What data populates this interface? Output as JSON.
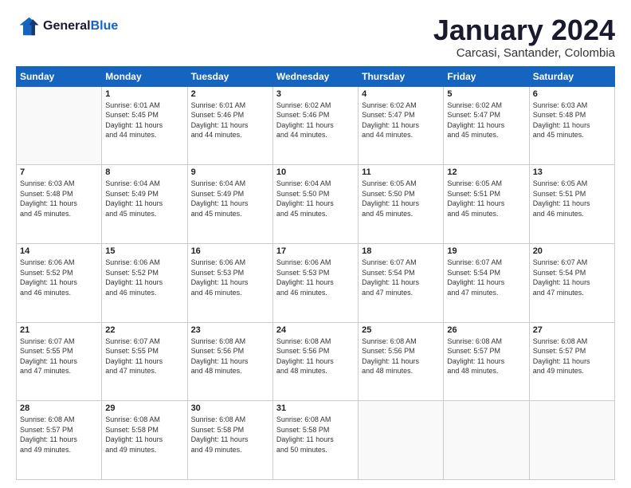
{
  "header": {
    "logo_general": "General",
    "logo_blue": "Blue",
    "month_title": "January 2024",
    "subtitle": "Carcasi, Santander, Colombia"
  },
  "days_of_week": [
    "Sunday",
    "Monday",
    "Tuesday",
    "Wednesday",
    "Thursday",
    "Friday",
    "Saturday"
  ],
  "weeks": [
    [
      {
        "day": "",
        "info": ""
      },
      {
        "day": "1",
        "info": "Sunrise: 6:01 AM\nSunset: 5:45 PM\nDaylight: 11 hours\nand 44 minutes."
      },
      {
        "day": "2",
        "info": "Sunrise: 6:01 AM\nSunset: 5:46 PM\nDaylight: 11 hours\nand 44 minutes."
      },
      {
        "day": "3",
        "info": "Sunrise: 6:02 AM\nSunset: 5:46 PM\nDaylight: 11 hours\nand 44 minutes."
      },
      {
        "day": "4",
        "info": "Sunrise: 6:02 AM\nSunset: 5:47 PM\nDaylight: 11 hours\nand 44 minutes."
      },
      {
        "day": "5",
        "info": "Sunrise: 6:02 AM\nSunset: 5:47 PM\nDaylight: 11 hours\nand 45 minutes."
      },
      {
        "day": "6",
        "info": "Sunrise: 6:03 AM\nSunset: 5:48 PM\nDaylight: 11 hours\nand 45 minutes."
      }
    ],
    [
      {
        "day": "7",
        "info": "Sunrise: 6:03 AM\nSunset: 5:48 PM\nDaylight: 11 hours\nand 45 minutes."
      },
      {
        "day": "8",
        "info": "Sunrise: 6:04 AM\nSunset: 5:49 PM\nDaylight: 11 hours\nand 45 minutes."
      },
      {
        "day": "9",
        "info": "Sunrise: 6:04 AM\nSunset: 5:49 PM\nDaylight: 11 hours\nand 45 minutes."
      },
      {
        "day": "10",
        "info": "Sunrise: 6:04 AM\nSunset: 5:50 PM\nDaylight: 11 hours\nand 45 minutes."
      },
      {
        "day": "11",
        "info": "Sunrise: 6:05 AM\nSunset: 5:50 PM\nDaylight: 11 hours\nand 45 minutes."
      },
      {
        "day": "12",
        "info": "Sunrise: 6:05 AM\nSunset: 5:51 PM\nDaylight: 11 hours\nand 45 minutes."
      },
      {
        "day": "13",
        "info": "Sunrise: 6:05 AM\nSunset: 5:51 PM\nDaylight: 11 hours\nand 46 minutes."
      }
    ],
    [
      {
        "day": "14",
        "info": "Sunrise: 6:06 AM\nSunset: 5:52 PM\nDaylight: 11 hours\nand 46 minutes."
      },
      {
        "day": "15",
        "info": "Sunrise: 6:06 AM\nSunset: 5:52 PM\nDaylight: 11 hours\nand 46 minutes."
      },
      {
        "day": "16",
        "info": "Sunrise: 6:06 AM\nSunset: 5:53 PM\nDaylight: 11 hours\nand 46 minutes."
      },
      {
        "day": "17",
        "info": "Sunrise: 6:06 AM\nSunset: 5:53 PM\nDaylight: 11 hours\nand 46 minutes."
      },
      {
        "day": "18",
        "info": "Sunrise: 6:07 AM\nSunset: 5:54 PM\nDaylight: 11 hours\nand 47 minutes."
      },
      {
        "day": "19",
        "info": "Sunrise: 6:07 AM\nSunset: 5:54 PM\nDaylight: 11 hours\nand 47 minutes."
      },
      {
        "day": "20",
        "info": "Sunrise: 6:07 AM\nSunset: 5:54 PM\nDaylight: 11 hours\nand 47 minutes."
      }
    ],
    [
      {
        "day": "21",
        "info": "Sunrise: 6:07 AM\nSunset: 5:55 PM\nDaylight: 11 hours\nand 47 minutes."
      },
      {
        "day": "22",
        "info": "Sunrise: 6:07 AM\nSunset: 5:55 PM\nDaylight: 11 hours\nand 47 minutes."
      },
      {
        "day": "23",
        "info": "Sunrise: 6:08 AM\nSunset: 5:56 PM\nDaylight: 11 hours\nand 48 minutes."
      },
      {
        "day": "24",
        "info": "Sunrise: 6:08 AM\nSunset: 5:56 PM\nDaylight: 11 hours\nand 48 minutes."
      },
      {
        "day": "25",
        "info": "Sunrise: 6:08 AM\nSunset: 5:56 PM\nDaylight: 11 hours\nand 48 minutes."
      },
      {
        "day": "26",
        "info": "Sunrise: 6:08 AM\nSunset: 5:57 PM\nDaylight: 11 hours\nand 48 minutes."
      },
      {
        "day": "27",
        "info": "Sunrise: 6:08 AM\nSunset: 5:57 PM\nDaylight: 11 hours\nand 49 minutes."
      }
    ],
    [
      {
        "day": "28",
        "info": "Sunrise: 6:08 AM\nSunset: 5:57 PM\nDaylight: 11 hours\nand 49 minutes."
      },
      {
        "day": "29",
        "info": "Sunrise: 6:08 AM\nSunset: 5:58 PM\nDaylight: 11 hours\nand 49 minutes."
      },
      {
        "day": "30",
        "info": "Sunrise: 6:08 AM\nSunset: 5:58 PM\nDaylight: 11 hours\nand 49 minutes."
      },
      {
        "day": "31",
        "info": "Sunrise: 6:08 AM\nSunset: 5:58 PM\nDaylight: 11 hours\nand 50 minutes."
      },
      {
        "day": "",
        "info": ""
      },
      {
        "day": "",
        "info": ""
      },
      {
        "day": "",
        "info": ""
      }
    ]
  ]
}
